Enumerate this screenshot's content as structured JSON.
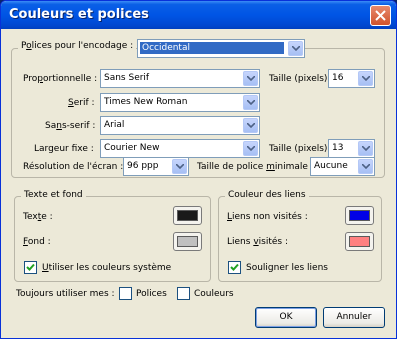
{
  "window": {
    "title": "Couleurs et polices"
  },
  "fonts": {
    "encoding_label": "Polices pour l'encodage :",
    "encoding_value": "Occidental",
    "proportional_label": "Proportionnelle :",
    "proportional_value": "Sans Serif",
    "proportional_size_label": "Taille (pixels)",
    "proportional_size_value": "16",
    "serif_label": "Serif :",
    "serif_value": "Times New Roman",
    "sans_serif_label": "Sans-serif :",
    "sans_serif_value": "Arial",
    "monospace_label": "Largeur fixe :",
    "monospace_value": "Courier New",
    "monospace_size_label": "Taille (pixels)",
    "monospace_size_value": "13",
    "resolution_label": "Résolution de l'écran :",
    "resolution_value": "96 ppp",
    "min_size_label": "Taille de police minimale :",
    "min_size_value": "Aucune"
  },
  "text_bg": {
    "legend": "Texte et fond",
    "text_label": "Texte :",
    "text_color": "#1a1a1a",
    "bg_label": "Fond :",
    "bg_color": "#c0c0c0",
    "system_colors_label": "Utiliser les couleurs système",
    "system_colors_checked": true
  },
  "links": {
    "legend": "Couleur des liens",
    "unvisited_label": "Liens non visités :",
    "unvisited_color": "#0000e6",
    "visited_label": "Liens visités :",
    "visited_color": "#ff8080",
    "underline_label": "Souligner les liens",
    "underline_checked": true
  },
  "always_use": {
    "label": "Toujours utiliser mes :",
    "fonts_label": "Polices",
    "fonts_checked": false,
    "colors_label": "Couleurs",
    "colors_checked": false
  },
  "buttons": {
    "ok": "OK",
    "cancel": "Annuler"
  },
  "colors": {
    "title_bar": "#0055e5",
    "dialog_bg": "#ece9d8",
    "selection": "#316ac5"
  }
}
